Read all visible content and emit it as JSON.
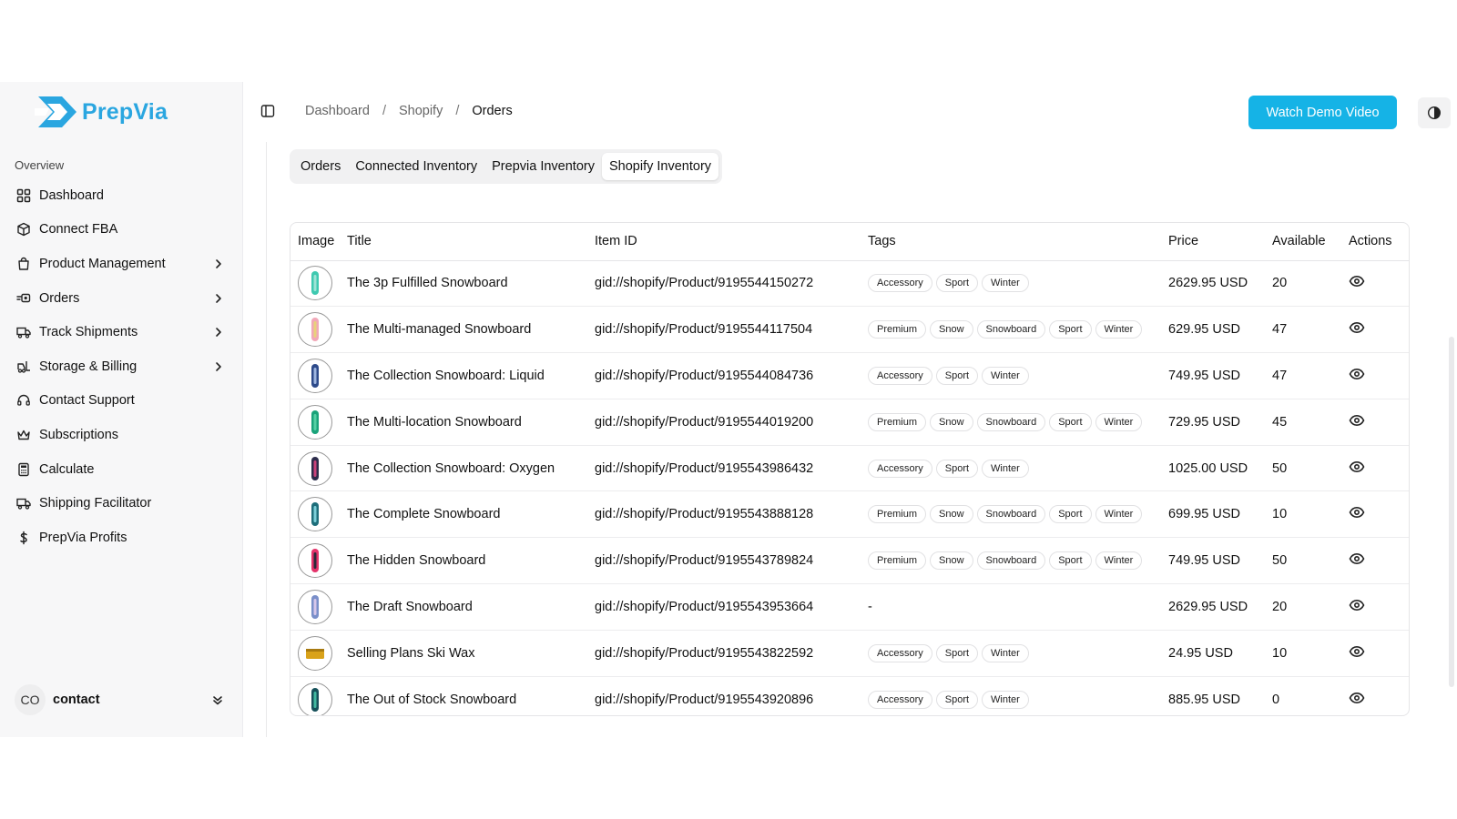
{
  "brand": {
    "name": "PrepVia",
    "color": "#2aa6e0"
  },
  "sidebar": {
    "section_label": "Overview",
    "items": [
      {
        "label": "Dashboard",
        "icon": "dashboard-grid-icon",
        "has_children": false
      },
      {
        "label": "Connect FBA",
        "icon": "box-icon",
        "has_children": false
      },
      {
        "label": "Product Management",
        "icon": "shopping-bag-icon",
        "has_children": true
      },
      {
        "label": "Orders",
        "icon": "orders-icon",
        "has_children": true
      },
      {
        "label": "Track Shipments",
        "icon": "truck-icon",
        "has_children": true
      },
      {
        "label": "Storage & Billing",
        "icon": "forklift-icon",
        "has_children": true
      },
      {
        "label": "Contact Support",
        "icon": "headset-icon",
        "has_children": false
      },
      {
        "label": "Subscriptions",
        "icon": "crown-icon",
        "has_children": false
      },
      {
        "label": "Calculate",
        "icon": "calculator-icon",
        "has_children": false
      },
      {
        "label": "Shipping Facilitator",
        "icon": "truck-icon",
        "has_children": false
      },
      {
        "label": "PrepVia Profits",
        "icon": "dollar-icon",
        "has_children": false
      }
    ],
    "user": {
      "initials": "CO",
      "name": "contact"
    }
  },
  "header": {
    "breadcrumb": [
      "Dashboard",
      "Shopify",
      "Orders"
    ],
    "demo_button": "Watch Demo Video",
    "accent": "#15b3e6"
  },
  "tabs": [
    "Orders",
    "Connected Inventory",
    "Prepvia Inventory",
    "Shopify Inventory"
  ],
  "active_tab": "Shopify Inventory",
  "table": {
    "columns": [
      "Image",
      "Title",
      "Item ID",
      "Tags",
      "Price",
      "Available",
      "Actions"
    ],
    "rows": [
      {
        "title": "The 3p Fulfilled Snowboard",
        "item_id": "gid://shopify/Product/9195544150272",
        "tags": [
          "Accessory",
          "Sport",
          "Winter"
        ],
        "price": "2629.95 USD",
        "available": "20",
        "thumb_colors": [
          "#3ec9b0",
          "#9ee3d6"
        ]
      },
      {
        "title": "The Multi-managed Snowboard",
        "item_id": "gid://shopify/Product/9195544117504",
        "tags": [
          "Premium",
          "Snow",
          "Snowboard",
          "Sport",
          "Winter"
        ],
        "price": "629.95 USD",
        "available": "47",
        "thumb_colors": [
          "#f1a8b8",
          "#e8d27a"
        ]
      },
      {
        "title": "The Collection Snowboard: Liquid",
        "item_id": "gid://shopify/Product/9195544084736",
        "tags": [
          "Accessory",
          "Sport",
          "Winter"
        ],
        "price": "749.95 USD",
        "available": "47",
        "thumb_colors": [
          "#2d4a8a",
          "#9fb6e0"
        ]
      },
      {
        "title": "The Multi-location Snowboard",
        "item_id": "gid://shopify/Product/9195544019200",
        "tags": [
          "Premium",
          "Snow",
          "Snowboard",
          "Sport",
          "Winter"
        ],
        "price": "729.95 USD",
        "available": "45",
        "thumb_colors": [
          "#1aa37a",
          "#56d0a5"
        ]
      },
      {
        "title": "The Collection Snowboard: Oxygen",
        "item_id": "gid://shopify/Product/9195543986432",
        "tags": [
          "Accessory",
          "Sport",
          "Winter"
        ],
        "price": "1025.00 USD",
        "available": "50",
        "thumb_colors": [
          "#2b2b4a",
          "#c9427a"
        ]
      },
      {
        "title": "The Complete Snowboard",
        "item_id": "gid://shopify/Product/9195543888128",
        "tags": [
          "Premium",
          "Snow",
          "Snowboard",
          "Sport",
          "Winter"
        ],
        "price": "699.95 USD",
        "available": "10",
        "thumb_colors": [
          "#1e6e7a",
          "#7ccfd8"
        ]
      },
      {
        "title": "The Hidden Snowboard",
        "item_id": "gid://shopify/Product/9195543789824",
        "tags": [
          "Premium",
          "Snow",
          "Snowboard",
          "Sport",
          "Winter"
        ],
        "price": "749.95 USD",
        "available": "50",
        "thumb_colors": [
          "#e4336b",
          "#2a2a3a"
        ]
      },
      {
        "title": "The Draft Snowboard",
        "item_id": "gid://shopify/Product/9195543953664",
        "tags": [],
        "price": "2629.95 USD",
        "available": "20",
        "thumb_colors": [
          "#7a8fc9",
          "#d7c7ea"
        ]
      },
      {
        "title": "Selling Plans Ski Wax",
        "item_id": "gid://shopify/Product/9195543822592",
        "tags": [
          "Accessory",
          "Sport",
          "Winter"
        ],
        "price": "24.95 USD",
        "available": "10",
        "thumb_colors": [
          "#d9a21a",
          "#a87a10"
        ],
        "thumb_shape": "wax"
      },
      {
        "title": "The Out of Stock Snowboard",
        "item_id": "gid://shopify/Product/9195543920896",
        "tags": [
          "Accessory",
          "Sport",
          "Winter"
        ],
        "price": "885.95 USD",
        "available": "0",
        "thumb_colors": [
          "#15505a",
          "#41b8a0"
        ]
      }
    ],
    "empty_tags": "-"
  }
}
